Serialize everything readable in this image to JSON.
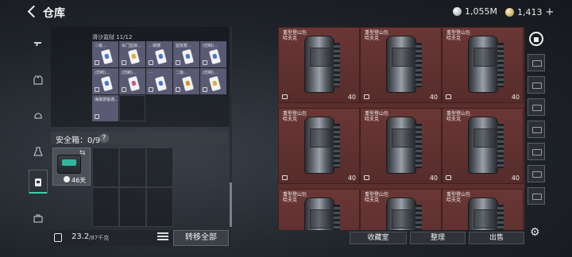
{
  "header": {
    "title": "仓库",
    "currency_silver": "1,055M",
    "currency_gold": "1,413",
    "plus": "+"
  },
  "backpack": {
    "container_label": "滑沙监狱 11/12",
    "slots": [
      {
        "name": "二级…",
        "card": "blue"
      },
      {
        "name": "水门监狱…",
        "card": "gold"
      },
      {
        "name": "…保镖",
        "card": "blue"
      },
      {
        "name": "监狱复…",
        "card": "blue"
      },
      {
        "name": "(仿制)…",
        "card": "blue"
      },
      {
        "name": "(仿制)…",
        "card": "blue"
      },
      {
        "name": "(仿制)…",
        "card": "pink"
      },
      {
        "name": "…",
        "card": "blue"
      },
      {
        "name": "二级…",
        "card": "orange"
      },
      {
        "name": "(仿制)…",
        "card": "gold"
      },
      {
        "name": "海坡游客通…",
        "card": "blue"
      }
    ]
  },
  "safe_box": {
    "label": "安全箱：0/9",
    "help": "?",
    "timer": "46天"
  },
  "footer": {
    "weight": "23.2",
    "weight_max": "/87千克",
    "transfer_all": "转移全部"
  },
  "warehouse": {
    "item_name_line1": "重型登山包",
    "item_name_line2": "哈夫克",
    "weight": "40",
    "buttons": {
      "collection": "收藏室",
      "organize": "整理",
      "sell": "出售"
    }
  }
}
